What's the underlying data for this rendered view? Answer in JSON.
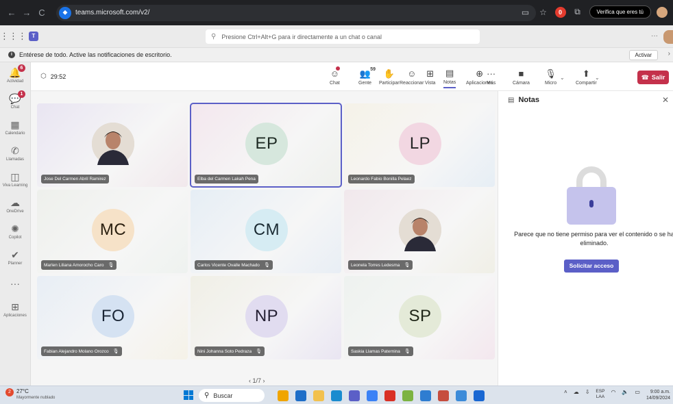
{
  "browser": {
    "url": "teams.microsoft.com/v2/",
    "back": "←",
    "forward": "→",
    "reload": "C",
    "verify_label": "Verifica que eres tú",
    "extension_badge": "0"
  },
  "teams_top": {
    "search_placeholder": "Presione Ctrl+Alt+G para ir directamente a un chat o canal",
    "more": "···"
  },
  "banner": {
    "text": "Entérese de todo. Active las notificaciones de escritorio.",
    "activate_label": "Activar"
  },
  "rail": [
    {
      "label": "Actividad",
      "icon": "bell-icon",
      "glyph": "🔔",
      "badge": "6"
    },
    {
      "label": "Chat",
      "icon": "chat-icon",
      "glyph": "💬",
      "badge": "1"
    },
    {
      "label": "Calendario",
      "icon": "calendar-icon",
      "glyph": "▦"
    },
    {
      "label": "Llamadas",
      "icon": "phone-icon",
      "glyph": "✆"
    },
    {
      "label": "Viva Learning",
      "icon": "learning-icon",
      "glyph": "◫"
    },
    {
      "label": "OneDrive",
      "icon": "cloud-icon",
      "glyph": "☁"
    },
    {
      "label": "Copilot",
      "icon": "copilot-icon",
      "glyph": "✺"
    },
    {
      "label": "Planner",
      "icon": "planner-icon",
      "glyph": "✔"
    },
    {
      "label": "",
      "icon": "more-icon",
      "glyph": "···"
    },
    {
      "label": "Aplicaciones",
      "icon": "add-apps-icon",
      "glyph": "⊞"
    }
  ],
  "meeting": {
    "timer": "29:52",
    "toolbar": [
      {
        "label": "Chat",
        "icon": "chat-icon",
        "glyph": "☺"
      },
      {
        "label": "Gente",
        "icon": "people-icon",
        "glyph": "👥",
        "count": "59"
      },
      {
        "label": "Participar",
        "icon": "raise-hand-icon",
        "glyph": "✋"
      },
      {
        "label": "Reaccionar",
        "icon": "react-icon",
        "glyph": "☺"
      },
      {
        "label": "Vista",
        "icon": "view-icon",
        "glyph": "⊞"
      },
      {
        "label": "Notas",
        "icon": "notes-icon",
        "glyph": "▤"
      },
      {
        "label": "Aplicaciones",
        "icon": "apps-icon",
        "glyph": "⊕"
      },
      {
        "label": "Más",
        "icon": "more-icon",
        "glyph": "···"
      },
      {
        "label": "Cámara",
        "icon": "camera-off-icon",
        "glyph": "■"
      },
      {
        "label": "Micro",
        "icon": "mic-icon",
        "glyph": "🎙"
      },
      {
        "label": "Compartir",
        "icon": "share-icon",
        "glyph": "⬆"
      }
    ],
    "leave_label": "Salir"
  },
  "participants": [
    {
      "name": "Jose Del Carmen Abril Ramirez",
      "initials": "",
      "photo": true,
      "muted": false
    },
    {
      "name": "Elba del Carmen Lakah Pena",
      "initials": "EP",
      "photo": false,
      "muted": false,
      "active": true
    },
    {
      "name": "Leonardo Fabio Bonilla Pelaez",
      "initials": "LP",
      "photo": false,
      "muted": false
    },
    {
      "name": "Marlen Liliana Amorocho Caro",
      "initials": "MC",
      "photo": false,
      "muted": true
    },
    {
      "name": "Carlos Vicente Ovalle Machado",
      "initials": "CM",
      "photo": false,
      "muted": true
    },
    {
      "name": "Leonela Torres Ledesma",
      "initials": "",
      "photo": true,
      "muted": true
    },
    {
      "name": "Fabian Alejandro Molano Orozco",
      "initials": "FO",
      "photo": false,
      "muted": true
    },
    {
      "name": "Nini Johanna Soto Pedraza",
      "initials": "NP",
      "photo": false,
      "muted": true
    },
    {
      "name": "Saskia Llamas Paternina",
      "initials": "SP",
      "photo": false,
      "muted": true
    }
  ],
  "pagination": "‹  1/7  ›",
  "notes": {
    "title": "Notas",
    "message": "Parece que no tiene permiso para ver el contenido o se ha eliminado.",
    "request_label": "Solicitar acceso"
  },
  "taskbar": {
    "weather_badge": "2",
    "temperature": "27°C",
    "weather_desc": "Mayormente nublado",
    "search_label": "Buscar",
    "lang": "ESP",
    "lang_sub": "LAA",
    "time": "9:00 a.m.",
    "date": "14/09/2024"
  },
  "colors": {
    "accent": "#5b5fc7",
    "leave": "#c4314b"
  }
}
